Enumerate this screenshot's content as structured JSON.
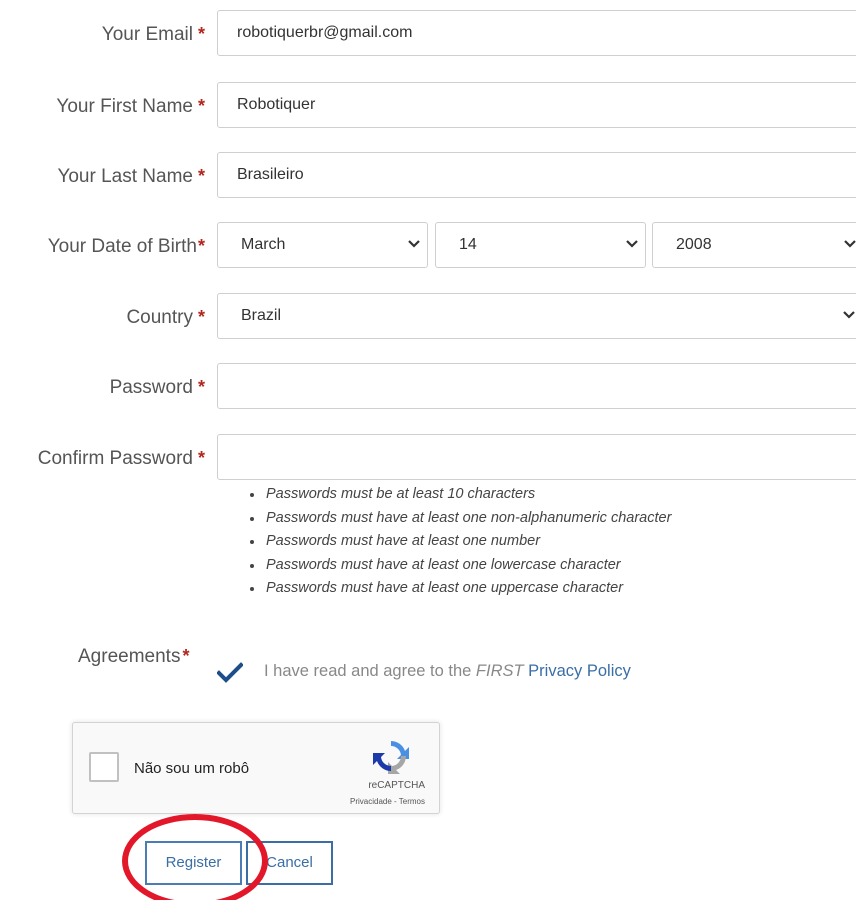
{
  "form": {
    "email": {
      "label": "Your Email",
      "value": "robotiquerbr@gmail.com"
    },
    "first_name": {
      "label": "Your First Name",
      "value": "Robotiquer"
    },
    "last_name": {
      "label": "Your Last Name",
      "value": "Brasileiro"
    },
    "dob": {
      "label": "Your Date of Birth",
      "month": "March",
      "day": "14",
      "year": "2008"
    },
    "country": {
      "label": "Country",
      "value": "Brazil"
    },
    "password": {
      "label": "Password",
      "value": ""
    },
    "confirm_password": {
      "label": "Confirm Password",
      "value": ""
    },
    "required_marker": "*",
    "password_rules": [
      "Passwords must be at least 10 characters",
      "Passwords must have at least one non-alphanumeric character",
      "Passwords must have at least one number",
      "Passwords must have at least one lowercase character",
      "Passwords must have at least one uppercase character"
    ],
    "agreements": {
      "label": "Agreements",
      "checked": true,
      "text_prefix": "I have read and agree to the ",
      "text_org": "FIRST",
      "link_text": "Privacy Policy"
    }
  },
  "captcha": {
    "label": "Não sou um robô",
    "brand": "reCAPTCHA",
    "terms": "Privacidade - Termos"
  },
  "buttons": {
    "register": "Register",
    "cancel": "Cancel"
  },
  "colors": {
    "accent": "#3a6ea5",
    "required": "#b3261e",
    "annotation": "#e3172a",
    "checkmark": "#1c4f8a"
  },
  "icons": {
    "select": "chevron-down-icon",
    "checkbox": "checkmark-icon",
    "captcha": "recaptcha-logo-icon"
  }
}
